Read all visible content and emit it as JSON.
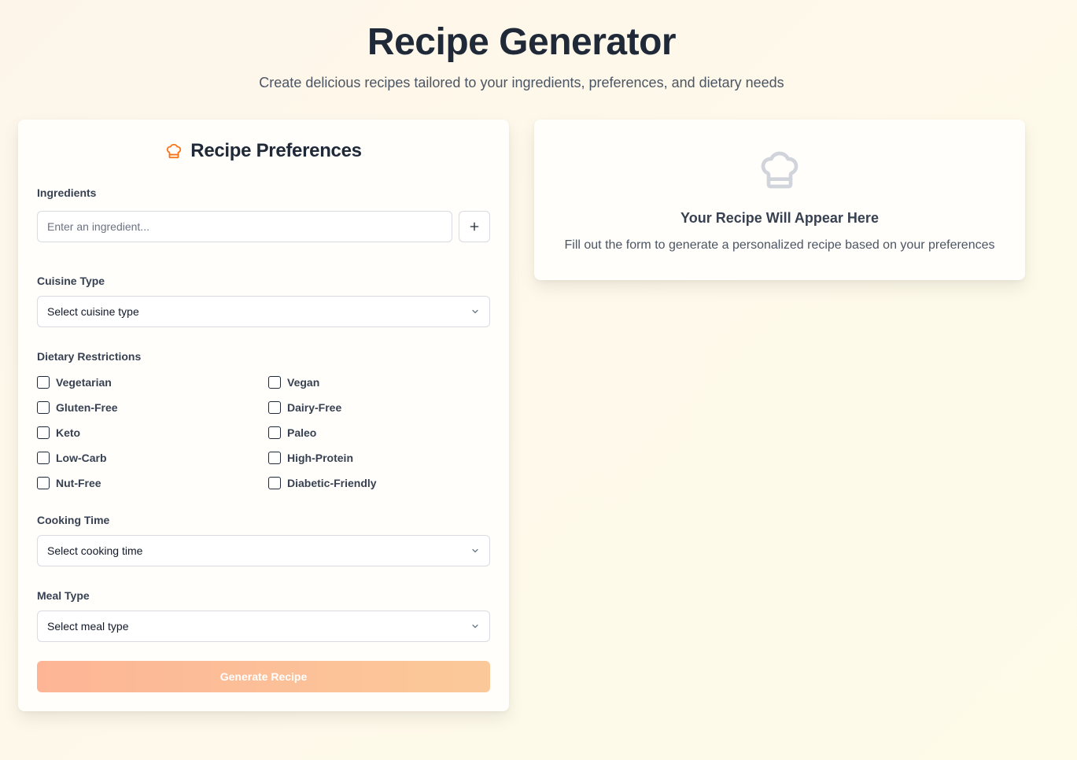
{
  "header": {
    "title": "Recipe Generator",
    "subtitle": "Create delicious recipes tailored to your ingredients, preferences, and dietary needs"
  },
  "form": {
    "title": "Recipe Preferences",
    "icon": "chef-hat-icon",
    "ingredients": {
      "label": "Ingredients",
      "placeholder": "Enter an ingredient...",
      "value": "",
      "add_icon": "plus-icon"
    },
    "cuisine": {
      "label": "Cuisine Type",
      "selected": "Select cuisine type"
    },
    "dietary": {
      "label": "Dietary Restrictions",
      "options": [
        {
          "label": "Vegetarian",
          "checked": false
        },
        {
          "label": "Vegan",
          "checked": false
        },
        {
          "label": "Gluten-Free",
          "checked": false
        },
        {
          "label": "Dairy-Free",
          "checked": false
        },
        {
          "label": "Keto",
          "checked": false
        },
        {
          "label": "Paleo",
          "checked": false
        },
        {
          "label": "Low-Carb",
          "checked": false
        },
        {
          "label": "High-Protein",
          "checked": false
        },
        {
          "label": "Nut-Free",
          "checked": false
        },
        {
          "label": "Diabetic-Friendly",
          "checked": false
        }
      ]
    },
    "cooking_time": {
      "label": "Cooking Time",
      "selected": "Select cooking time"
    },
    "meal_type": {
      "label": "Meal Type",
      "selected": "Select meal type"
    },
    "submit_label": "Generate Recipe"
  },
  "result": {
    "icon": "chef-hat-icon",
    "title": "Your Recipe Will Appear Here",
    "text": "Fill out the form to generate a personalized recipe based on your preferences"
  },
  "colors": {
    "accent": "#f97316",
    "button_start": "#fdb596",
    "button_end": "#fbc999",
    "placeholder_icon": "#d1d5db"
  }
}
